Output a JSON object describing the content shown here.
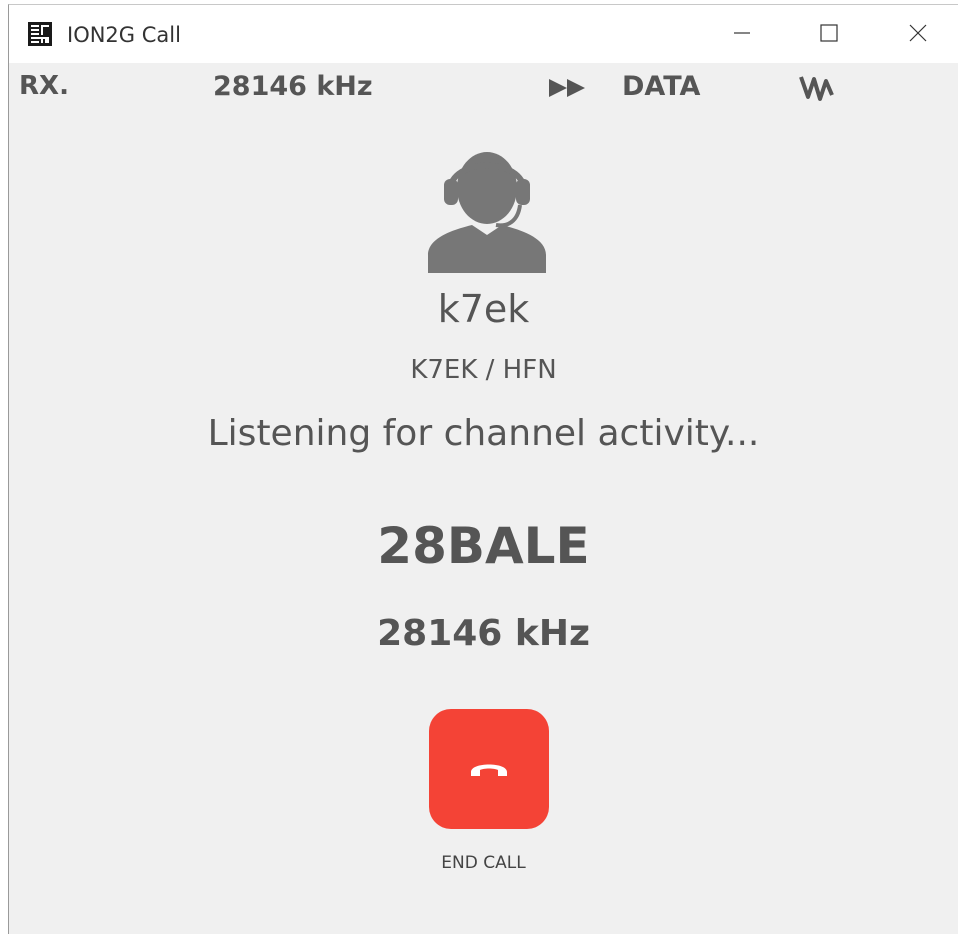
{
  "window": {
    "title": "ION2G Call",
    "controls": [
      "minimize",
      "maximize",
      "close"
    ]
  },
  "status_bar": {
    "mode": "RX.",
    "frequency": "28146 kHz",
    "data_label": "DATA",
    "icons": [
      "fast-forward-icon",
      "waveform-icon"
    ]
  },
  "contact": {
    "avatar_icon": "headset-person-icon",
    "username": "k7ek",
    "callsign": "K7EK / HFN",
    "status": "Listening for channel activity...",
    "channel": "28BALE",
    "frequency": "28146 kHz"
  },
  "end_call": {
    "label": "END CALL",
    "icon": "hang-up-phone-icon",
    "color": "#f44336"
  },
  "colors": {
    "background": "#f0f0f0",
    "text": "#555555",
    "end_call": "#f44336"
  }
}
